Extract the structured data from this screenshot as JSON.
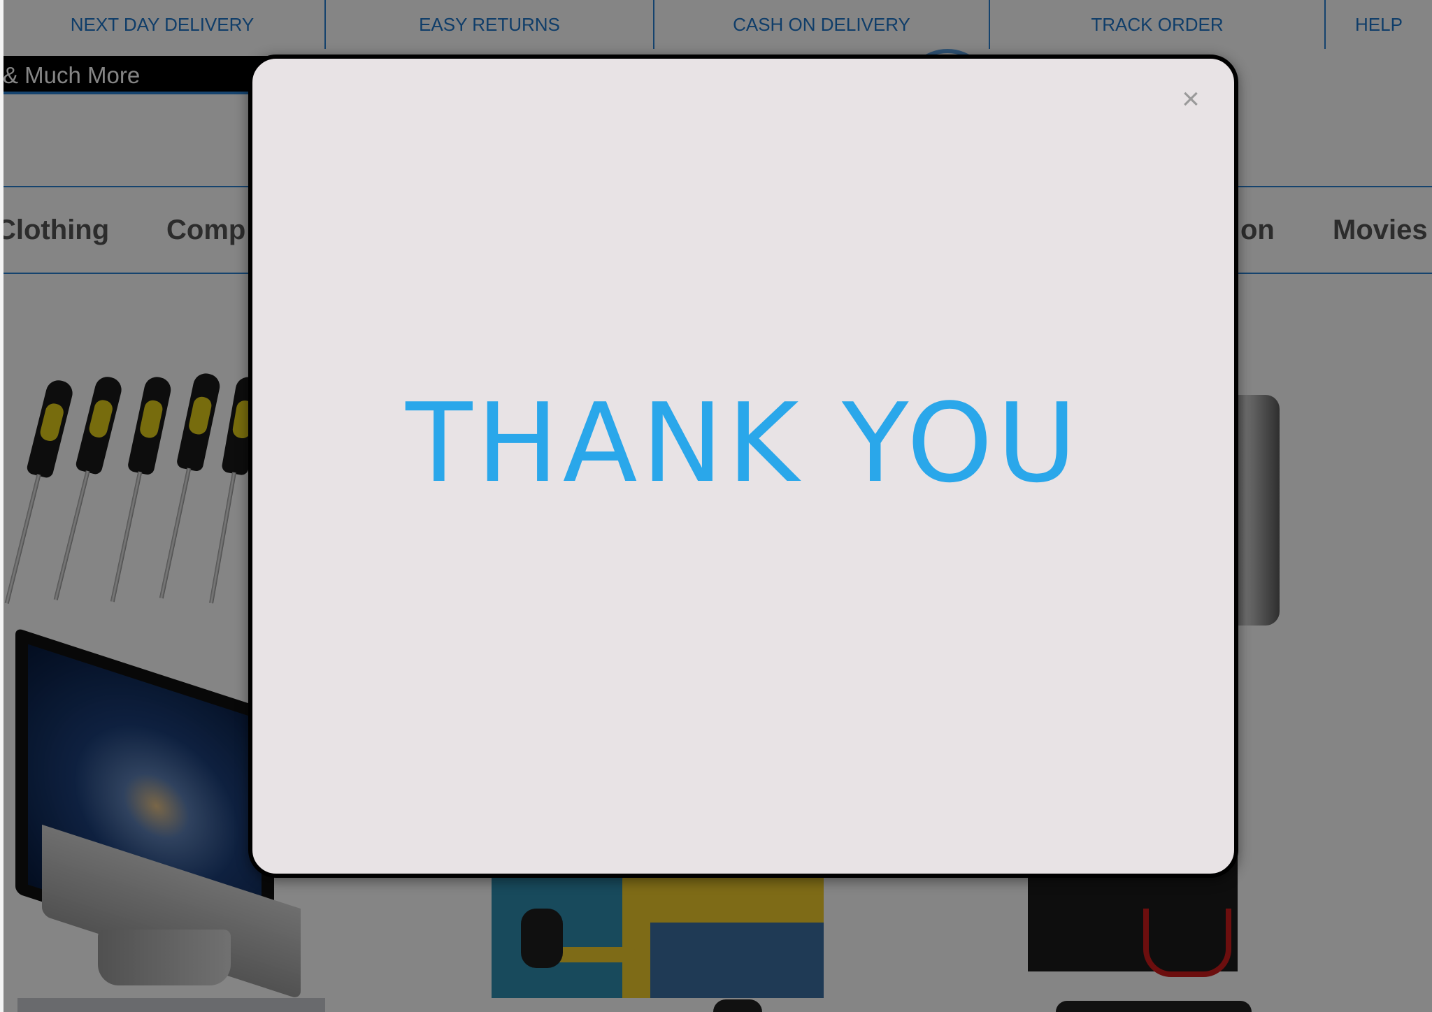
{
  "topbar": {
    "items": [
      "NEXT DAY DELIVERY",
      "EASY RETURNS",
      "CASH ON DELIVERY",
      "TRACK ORDER",
      "HELP"
    ]
  },
  "promo": {
    "text": "& Much More"
  },
  "categories": {
    "items": [
      "Clothing",
      "Comp",
      "on",
      "Movies"
    ]
  },
  "modal": {
    "message": "THANK YOU",
    "close_label": "×"
  },
  "colors": {
    "accent": "#2aa7ea",
    "nav_blue": "#1d75c9",
    "modal_bg": "#e8e3e5"
  }
}
